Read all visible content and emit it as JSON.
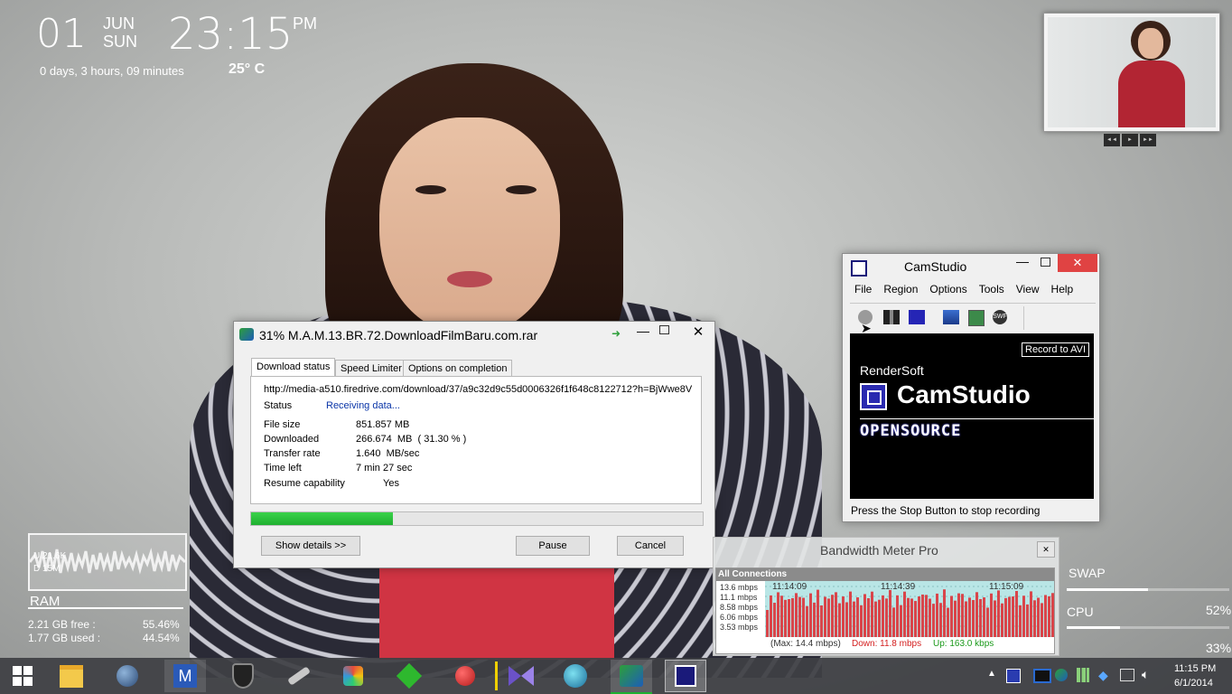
{
  "clock": {
    "day": "01",
    "month": "JUN",
    "weekday": "SUN",
    "time": "23:15",
    "ampm": "PM",
    "uptime": "0 days, 3 hours, 09 minutes",
    "temperature": "25° C"
  },
  "net_widget": {
    "up": "U 21.6K",
    "down": "D 15M"
  },
  "ram": {
    "label": "RAM",
    "free_text": "2.21 GB free :",
    "free_pct": "55.46%",
    "used_text": "1.77 GB used :",
    "used_pct": "44.54%"
  },
  "swap": {
    "label": "SWAP",
    "level": 0.5
  },
  "cpu": {
    "label": "CPU",
    "value1": "52%",
    "value2": "33%"
  },
  "media": {
    "prev": "◄◄",
    "play": "►",
    "next": "►►"
  },
  "idm": {
    "title": "31% M.A.M.13.BR.72.DownloadFilmBaru.com.rar",
    "tabs": [
      "Download status",
      "Speed Limiter",
      "Options on completion"
    ],
    "url": "http://media-a510.firedrive.com/download/37/a9c32d9c55d0006326f1f648c8122712?h=BjWwe8V",
    "status_label": "Status",
    "status_value": "Receiving data...",
    "rows": [
      {
        "label": "File size",
        "value": "851.857  MB"
      },
      {
        "label": "Downloaded",
        "value": "266.674  MB  ( 31.30 % )"
      },
      {
        "label": "Transfer rate",
        "value": "1.640  MB/sec"
      },
      {
        "label": "Time left",
        "value": "7 min 27 sec"
      }
    ],
    "resume_label": "Resume capability",
    "resume_value": "Yes",
    "progress": 0.313,
    "show_details": "Show details >>",
    "pause": "Pause",
    "cancel": "Cancel"
  },
  "camstudio": {
    "title": "CamStudio",
    "menu": [
      "File",
      "Region",
      "Options",
      "Tools",
      "View",
      "Help"
    ],
    "record_avi": "Record to AVI",
    "rendersoft": "RenderSoft",
    "logo": "CamStudio",
    "opensource": "OPENSOURCE",
    "status": "Press the Stop Button to stop recording"
  },
  "bandwidth": {
    "title": "Bandwidth Meter Pro",
    "section": "All Connections",
    "y_labels": [
      "13.6 mbps",
      "11.1 mbps",
      "8.58 mbps",
      "6.06 mbps",
      "3.53 mbps"
    ],
    "time_labels": [
      "11:14:09",
      "11:14:39",
      "11:15:09"
    ],
    "max": "(Max: 14.4 mbps)",
    "down": "Down: 11.8 mbps",
    "up": "Up: 163.0 kbps",
    "bar_color": "#d9454a"
  },
  "taskbar": {
    "time": "11:15 PM",
    "date": "6/1/2014",
    "icons": [
      "windows-start-icon",
      "file-explorer-icon",
      "network-globe-icon",
      "m-app-icon",
      "shield-icon",
      "wrench-icon",
      "paint-icon",
      "f-app-icon",
      "apple-icon",
      "bowtie-icon",
      "globe-icon",
      "idm-icon",
      "camstudio-icon"
    ]
  },
  "colors": {
    "accent_green": "#1fb030",
    "link_blue": "#0b36a8",
    "taskbar": "#3e3f44"
  }
}
